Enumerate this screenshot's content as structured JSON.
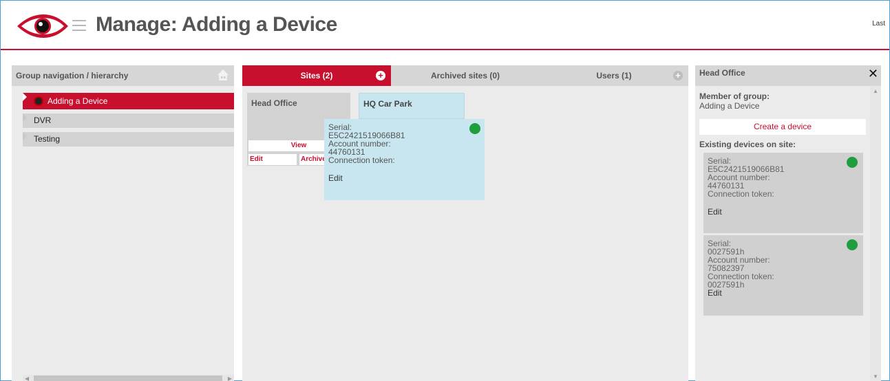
{
  "header": {
    "title": "Manage: Adding a Device",
    "right_text": "Last"
  },
  "left_panel": {
    "title": "Group navigation / hierarchy",
    "items": [
      {
        "label": "Adding a Device",
        "active": true
      },
      {
        "label": "DVR",
        "active": false
      },
      {
        "label": "Testing",
        "active": false
      }
    ]
  },
  "tabs": [
    {
      "label": "Sites (2)",
      "active": true
    },
    {
      "label": "Archived sites (0)",
      "active": false
    },
    {
      "label": "Users (1)",
      "active": false
    }
  ],
  "sites": {
    "head_office": {
      "title": "Head Office",
      "view_label": "View",
      "edit_label": "Edit",
      "archive_label": "Archive"
    },
    "hq_car_park": {
      "title": "HQ Car Park"
    }
  },
  "popup": {
    "serial_label": "Serial:",
    "serial": "E5C2421519066B81",
    "account_label": "Account number:",
    "account": "44760131",
    "token_label": "Connection token:",
    "edit_label": "Edit"
  },
  "right_panel": {
    "title": "Head Office",
    "member_label": "Member of group:",
    "member_value": "Adding a Device",
    "create_label": "Create a device",
    "existing_label": "Existing devices on site:",
    "devices": [
      {
        "serial_label": "Serial:",
        "serial": "E5C2421519066B81",
        "account_label": "Account number:",
        "account": "44760131",
        "token_label": "Connection token:",
        "token": "",
        "edit_label": "Edit"
      },
      {
        "serial_label": "Serial:",
        "serial": "0027591h",
        "account_label": "Account number:",
        "account": "75082397",
        "token_label": "Connection token:",
        "token": "0027591h",
        "edit_label": "Edit"
      }
    ]
  },
  "colors": {
    "accent": "#c8102e",
    "status_online": "#1e9e3c",
    "highlight": "#c8e6ef"
  }
}
